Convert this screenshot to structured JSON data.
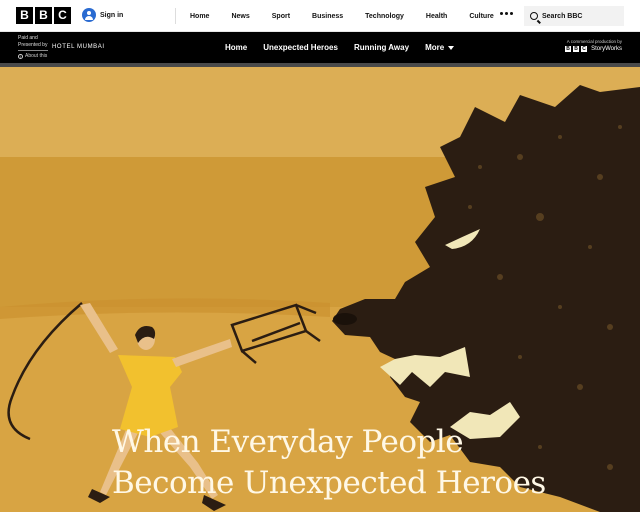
{
  "brand": {
    "logo_letters": [
      "B",
      "B",
      "C"
    ]
  },
  "account": {
    "sign_in_label": "Sign in"
  },
  "main_nav": {
    "items": [
      "Home",
      "News",
      "Sport",
      "Business",
      "Technology",
      "Health",
      "Culture"
    ]
  },
  "search": {
    "label": "Search BBC"
  },
  "sponsor": {
    "paid_line1": "Paid and",
    "paid_line2": "Presented by",
    "sponsor_name": "HOTEL MUMBAI",
    "about_label": "About this",
    "nav": [
      "Home",
      "Unexpected Heroes",
      "Running Away",
      "More"
    ],
    "commercial_label": "A commercial production by",
    "storyworks_label": "StoryWorks"
  },
  "hero": {
    "headline_line1": "When Everyday People",
    "headline_line2": "Become Unexpected Heroes"
  },
  "colors": {
    "hero_background": "#d9a440",
    "lion": "#2b1d12",
    "dress": "#f2c12e",
    "headline": "#fff8e6"
  }
}
